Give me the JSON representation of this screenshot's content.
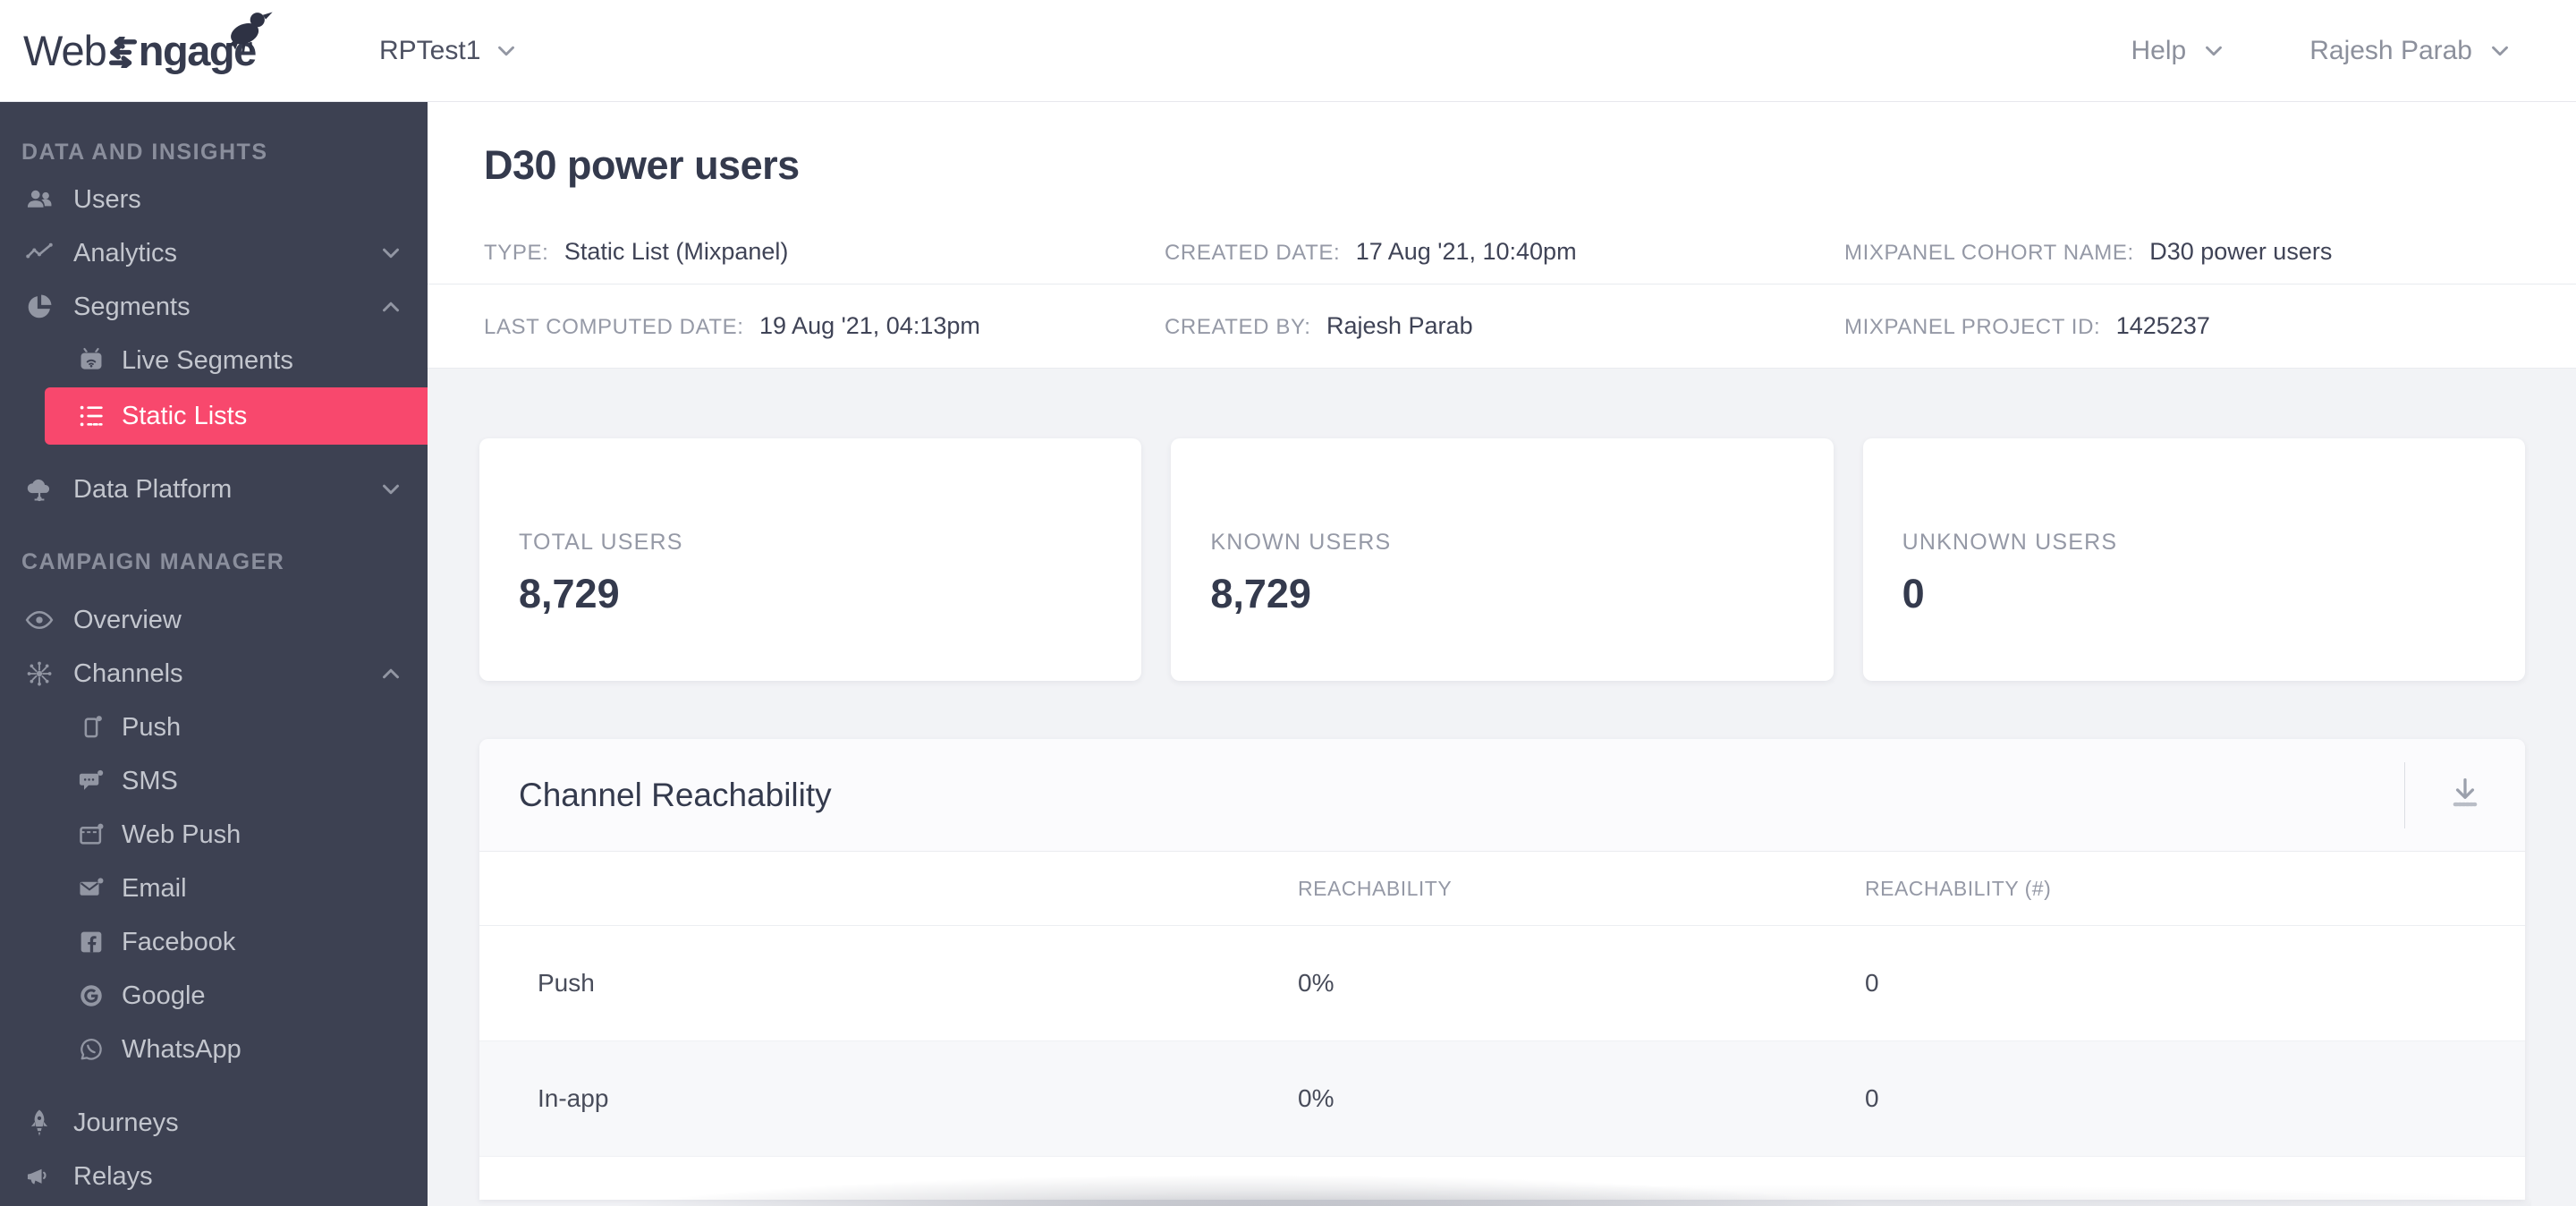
{
  "colors": {
    "accent_pink": "#f8486d",
    "sidebar_bg": "#3d4152",
    "page_bg": "#f2f3f6"
  },
  "header": {
    "logo_full": "WebEngage",
    "logo_web": "Web",
    "logo_ngage": "ngage",
    "project_name": "RPTest1",
    "help_label": "Help",
    "user_name": "Rajesh Parab"
  },
  "sidebar": {
    "sections": [
      {
        "label": "DATA AND INSIGHTS",
        "items": [
          {
            "label": "Users",
            "icon": "users-icon"
          },
          {
            "label": "Analytics",
            "icon": "analytics-icon",
            "chevron": "down"
          },
          {
            "label": "Segments",
            "icon": "segments-icon",
            "chevron": "up"
          },
          {
            "label": "Live Segments",
            "icon": "live-segments-icon",
            "sub": true
          },
          {
            "label": "Static Lists",
            "icon": "static-lists-icon",
            "sub": true,
            "active": true
          },
          {
            "label": "Data Platform",
            "icon": "data-platform-icon",
            "chevron": "down"
          }
        ]
      },
      {
        "label": "CAMPAIGN MANAGER",
        "items": [
          {
            "label": "Overview",
            "icon": "overview-icon"
          },
          {
            "label": "Channels",
            "icon": "channels-icon",
            "chevron": "up"
          },
          {
            "label": "Push",
            "icon": "push-icon",
            "sub": true
          },
          {
            "label": "SMS",
            "icon": "sms-icon",
            "sub": true
          },
          {
            "label": "Web Push",
            "icon": "web-push-icon",
            "sub": true
          },
          {
            "label": "Email",
            "icon": "email-icon",
            "sub": true
          },
          {
            "label": "Facebook",
            "icon": "facebook-icon",
            "sub": true
          },
          {
            "label": "Google",
            "icon": "google-icon",
            "sub": true
          },
          {
            "label": "WhatsApp",
            "icon": "whatsapp-icon",
            "sub": true
          },
          {
            "label": "Journeys",
            "icon": "journeys-icon"
          },
          {
            "label": "Relays",
            "icon": "relays-icon"
          }
        ]
      }
    ]
  },
  "page": {
    "title": "D30 power users",
    "meta": {
      "type_label": "TYPE:",
      "type_value": "Static List (Mixpanel)",
      "created_date_label": "CREATED DATE:",
      "created_date_value": "17 Aug '21, 10:40pm",
      "cohort_label": "MIXPANEL COHORT NAME:",
      "cohort_value": "D30 power users",
      "computed_label": "LAST COMPUTED DATE:",
      "computed_value": "19 Aug '21, 04:13pm",
      "created_by_label": "CREATED BY:",
      "created_by_value": "Rajesh Parab",
      "project_id_label": "MIXPANEL PROJECT ID:",
      "project_id_value": "1425237"
    },
    "stats": [
      {
        "label": "TOTAL USERS",
        "value": "8,729"
      },
      {
        "label": "KNOWN USERS",
        "value": "8,729"
      },
      {
        "label": "UNKNOWN USERS",
        "value": "0"
      }
    ],
    "reachability": {
      "title": "Channel Reachability",
      "columns": [
        "REACHABILITY",
        "REACHABILITY (#)"
      ],
      "rows": [
        {
          "channel": "Push",
          "reachability": "0%",
          "count": "0"
        },
        {
          "channel": "In-app",
          "reachability": "0%",
          "count": "0"
        }
      ]
    }
  }
}
